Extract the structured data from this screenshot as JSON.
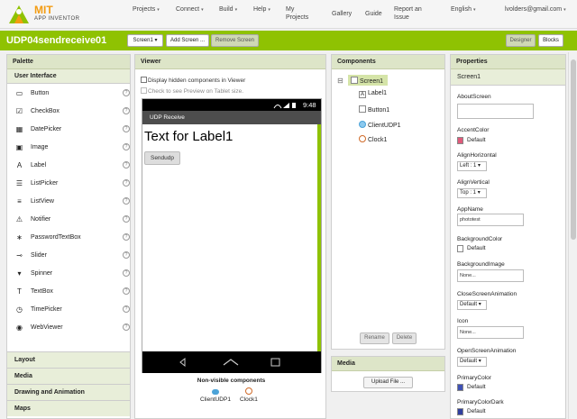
{
  "brand": {
    "mit": "MIT",
    "app_inventor": "APP INVENTOR"
  },
  "nav": {
    "projects": "Projects",
    "connect": "Connect",
    "build": "Build",
    "help": "Help",
    "my_projects_1": "My",
    "my_projects_2": "Projects",
    "gallery": "Gallery",
    "guide": "Guide",
    "report_1": "Report an",
    "report_2": "Issue",
    "language": "English",
    "account": "lvolders@gmail.com"
  },
  "project": {
    "name": "UDP04sendreceive01",
    "screen_select": "Screen1",
    "add_screen": "Add Screen ...",
    "remove_screen": "Remove Screen",
    "designer": "Designer",
    "blocks": "Blocks"
  },
  "palette": {
    "title": "Palette",
    "section": "User Interface",
    "items": [
      {
        "label": "Button",
        "icon": "button-icon"
      },
      {
        "label": "CheckBox",
        "icon": "checkbox-icon"
      },
      {
        "label": "DatePicker",
        "icon": "datepicker-icon"
      },
      {
        "label": "Image",
        "icon": "image-icon"
      },
      {
        "label": "Label",
        "icon": "label-icon"
      },
      {
        "label": "ListPicker",
        "icon": "listpicker-icon"
      },
      {
        "label": "ListView",
        "icon": "listview-icon"
      },
      {
        "label": "Notifier",
        "icon": "notifier-icon"
      },
      {
        "label": "PasswordTextBox",
        "icon": "password-icon"
      },
      {
        "label": "Slider",
        "icon": "slider-icon"
      },
      {
        "label": "Spinner",
        "icon": "spinner-icon"
      },
      {
        "label": "TextBox",
        "icon": "textbox-icon"
      },
      {
        "label": "TimePicker",
        "icon": "timepicker-icon"
      },
      {
        "label": "WebViewer",
        "icon": "webviewer-icon"
      }
    ],
    "categories": [
      "Layout",
      "Media",
      "Drawing and Animation",
      "Maps"
    ],
    "help_glyph": "?"
  },
  "viewer": {
    "title": "Viewer",
    "display_hidden": "Display hidden components in Viewer",
    "tablet_preview": "Check to see Preview on Tablet size.",
    "time": "9:48",
    "screen_title": "UDP Receive",
    "label_text": "Text for Label1",
    "button_text": "Sendudp",
    "nonvisible_title": "Non-visible components",
    "nonvisible": [
      "ClientUDP1",
      "Clock1"
    ]
  },
  "components": {
    "title": "Components",
    "root": "Screen1",
    "children": [
      "Label1",
      "Button1",
      "ClientUDP1",
      "Clock1"
    ],
    "rename": "Rename",
    "delete": "Delete",
    "collapse_glyph": "⊟"
  },
  "media": {
    "title": "Media",
    "upload": "Upload File ..."
  },
  "properties": {
    "title": "Properties",
    "screen": "Screen1",
    "about_screen": "AboutScreen",
    "accent_color": "AccentColor",
    "accent_value": "Default",
    "accent_hex": "#e05a7a",
    "align_h": "AlignHorizontal",
    "align_h_value": "Left : 1",
    "align_v": "AlignVertical",
    "align_v_value": "Top : 1",
    "app_name": "AppName",
    "app_name_value": "phototest",
    "bg_color": "BackgroundColor",
    "bg_color_value": "Default",
    "bg_color_hex": "#ffffff",
    "bg_image": "BackgroundImage",
    "bg_image_value": "None...",
    "close_anim": "CloseScreenAnimation",
    "close_anim_value": "Default",
    "icon": "Icon",
    "icon_value": "None...",
    "open_anim": "OpenScreenAnimation",
    "open_anim_value": "Default",
    "primary_color": "PrimaryColor",
    "primary_color_value": "Default",
    "primary_hex": "#3f51b5",
    "primary_dark": "PrimaryColorDark",
    "primary_dark_value": "Default",
    "primary_dark_hex": "#303f9f"
  },
  "colors": {
    "accent_green": "#8fc202",
    "brand_orange": "#f39c12"
  }
}
